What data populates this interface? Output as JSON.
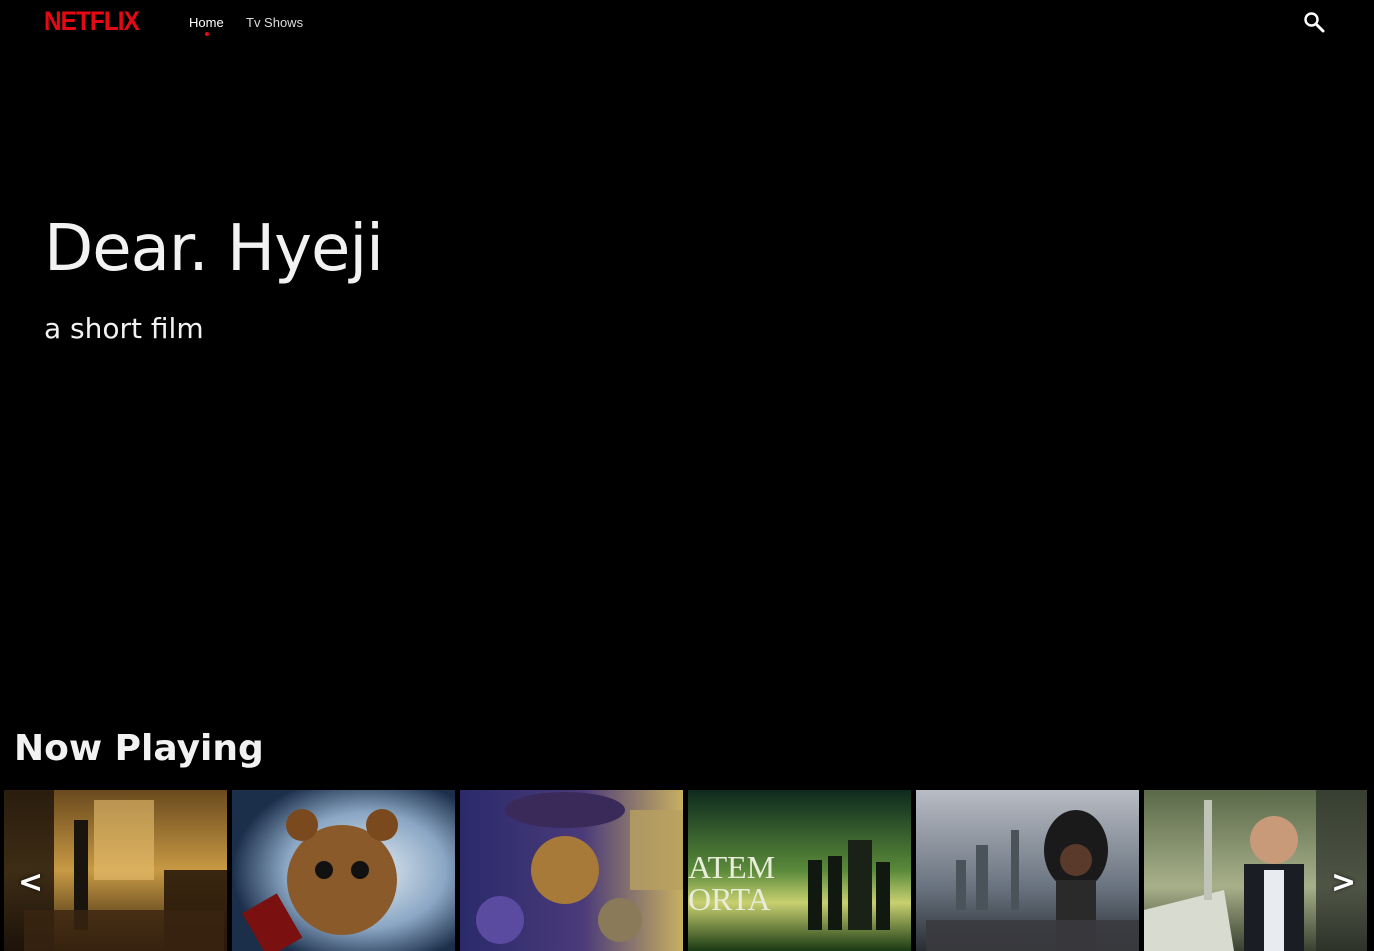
{
  "brand": {
    "logo_text": "NETFLIX",
    "color": "#e50914"
  },
  "nav": {
    "links": [
      {
        "label": "Home",
        "active": true
      },
      {
        "label": "Tv Shows",
        "active": false
      }
    ],
    "search_icon": "search-icon"
  },
  "hero": {
    "title": "Dear. Hyeji",
    "subtitle": "a short film"
  },
  "now_playing": {
    "heading": "Now Playing",
    "prev_label": "<",
    "next_label": ">",
    "posters": [
      {
        "name": "poster-church-gunman",
        "palette": [
          "#3a2a14",
          "#c8a24a",
          "#1a120a"
        ]
      },
      {
        "name": "poster-horror-bear",
        "palette": [
          "#1c2f4a",
          "#e6eef4",
          "#8a5a2a"
        ]
      },
      {
        "name": "poster-animated-cat",
        "palette": [
          "#2a2a6a",
          "#a88f3a",
          "#5a3a7a"
        ]
      },
      {
        "name": "poster-group-field",
        "palette": [
          "#143a28",
          "#7aa23a",
          "#d8e0c0"
        ]
      },
      {
        "name": "poster-warrior-city",
        "palette": [
          "#6a7a8a",
          "#2a2a2a",
          "#b8b8c0"
        ]
      },
      {
        "name": "poster-pilot-plane",
        "palette": [
          "#5a6a4a",
          "#b8c0a0",
          "#2a3028"
        ]
      }
    ]
  }
}
